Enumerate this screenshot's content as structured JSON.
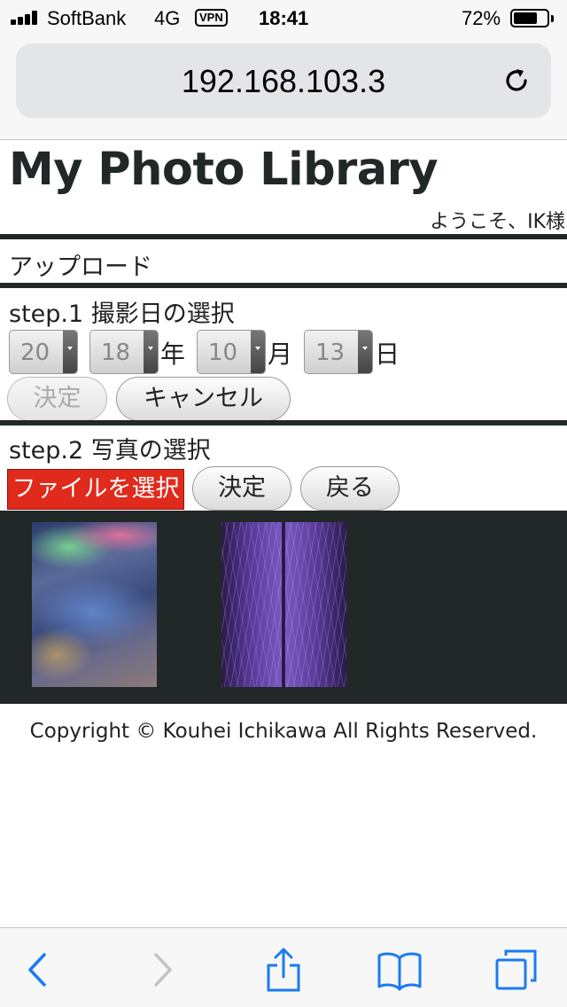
{
  "status_bar": {
    "carrier": "SoftBank",
    "network": "4G",
    "vpn": "VPN",
    "time": "18:41",
    "battery_percent": "72%",
    "battery_level": 0.72
  },
  "browser": {
    "url": "192.168.103.3",
    "reload_icon": "reload-icon"
  },
  "page": {
    "title": "My Photo Library",
    "welcome": "ようこそ、IK様",
    "upload_heading": "アップロード",
    "step1": {
      "heading": "step.1 撮影日の選択",
      "year_part1": "20",
      "year_part2": "18",
      "year_unit": "年",
      "month": "10",
      "month_unit": "月",
      "day": "13",
      "day_unit": "日",
      "confirm_label": "決定",
      "cancel_label": "キャンセル"
    },
    "step2": {
      "heading": "step.2 写真の選択",
      "choose_file_label": "ファイルを選択",
      "confirm_label": "決定",
      "back_label": "戻る"
    },
    "copyright": "Copyright © Kouhei Ichikawa All Rights Reserved."
  },
  "toolbar": {
    "icons": [
      "back-icon",
      "forward-icon",
      "share-icon",
      "bookmarks-icon",
      "tabs-icon"
    ]
  },
  "colors": {
    "accent_blue": "#1a7bf2",
    "dark_rule": "#222828",
    "file_button_red": "#e02a1c"
  }
}
